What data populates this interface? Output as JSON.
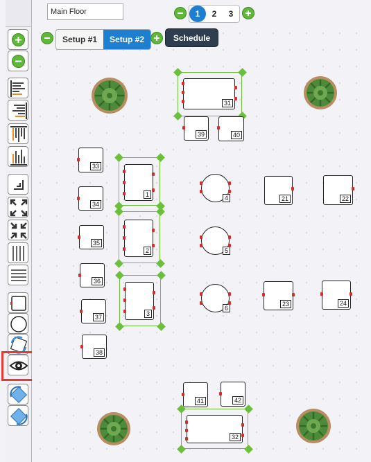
{
  "floor": {
    "name": "Main Floor"
  },
  "pages": [
    "1",
    "2",
    "3"
  ],
  "active_page": "1",
  "setups": [
    {
      "label": "Setup #1",
      "active": false
    },
    {
      "label": "Setup #2",
      "active": true
    }
  ],
  "toolbar": {
    "schedule_label": "Schedule"
  },
  "tables": [
    {
      "id": "31"
    },
    {
      "id": "39"
    },
    {
      "id": "40"
    },
    {
      "id": "33"
    },
    {
      "id": "34"
    },
    {
      "id": "35"
    },
    {
      "id": "36"
    },
    {
      "id": "37"
    },
    {
      "id": "38"
    },
    {
      "id": "1"
    },
    {
      "id": "2"
    },
    {
      "id": "3"
    },
    {
      "id": "4"
    },
    {
      "id": "5"
    },
    {
      "id": "6"
    },
    {
      "id": "21"
    },
    {
      "id": "22"
    },
    {
      "id": "23"
    },
    {
      "id": "24"
    },
    {
      "id": "41"
    },
    {
      "id": "42"
    },
    {
      "id": "32"
    }
  ],
  "sidebar_tools": [
    "add-icon",
    "remove-icon",
    "align-left-icon",
    "align-right-icon",
    "align-top-icon",
    "align-bottom-icon",
    "snap-corner-icon",
    "expand-icon",
    "shrink-icon",
    "distribute-horizontal-icon",
    "distribute-vertical-icon",
    "square-table-icon",
    "round-table-icon",
    "rotate-icon",
    "eye-icon",
    "rotate-cw-icon",
    "rotate-ccw-icon"
  ],
  "colors": {
    "accent": "#1e7fd0",
    "selection": "#6cbf3a",
    "seat": "#d62b2b",
    "add": "#5fb83a",
    "highlight": "#e53935"
  }
}
